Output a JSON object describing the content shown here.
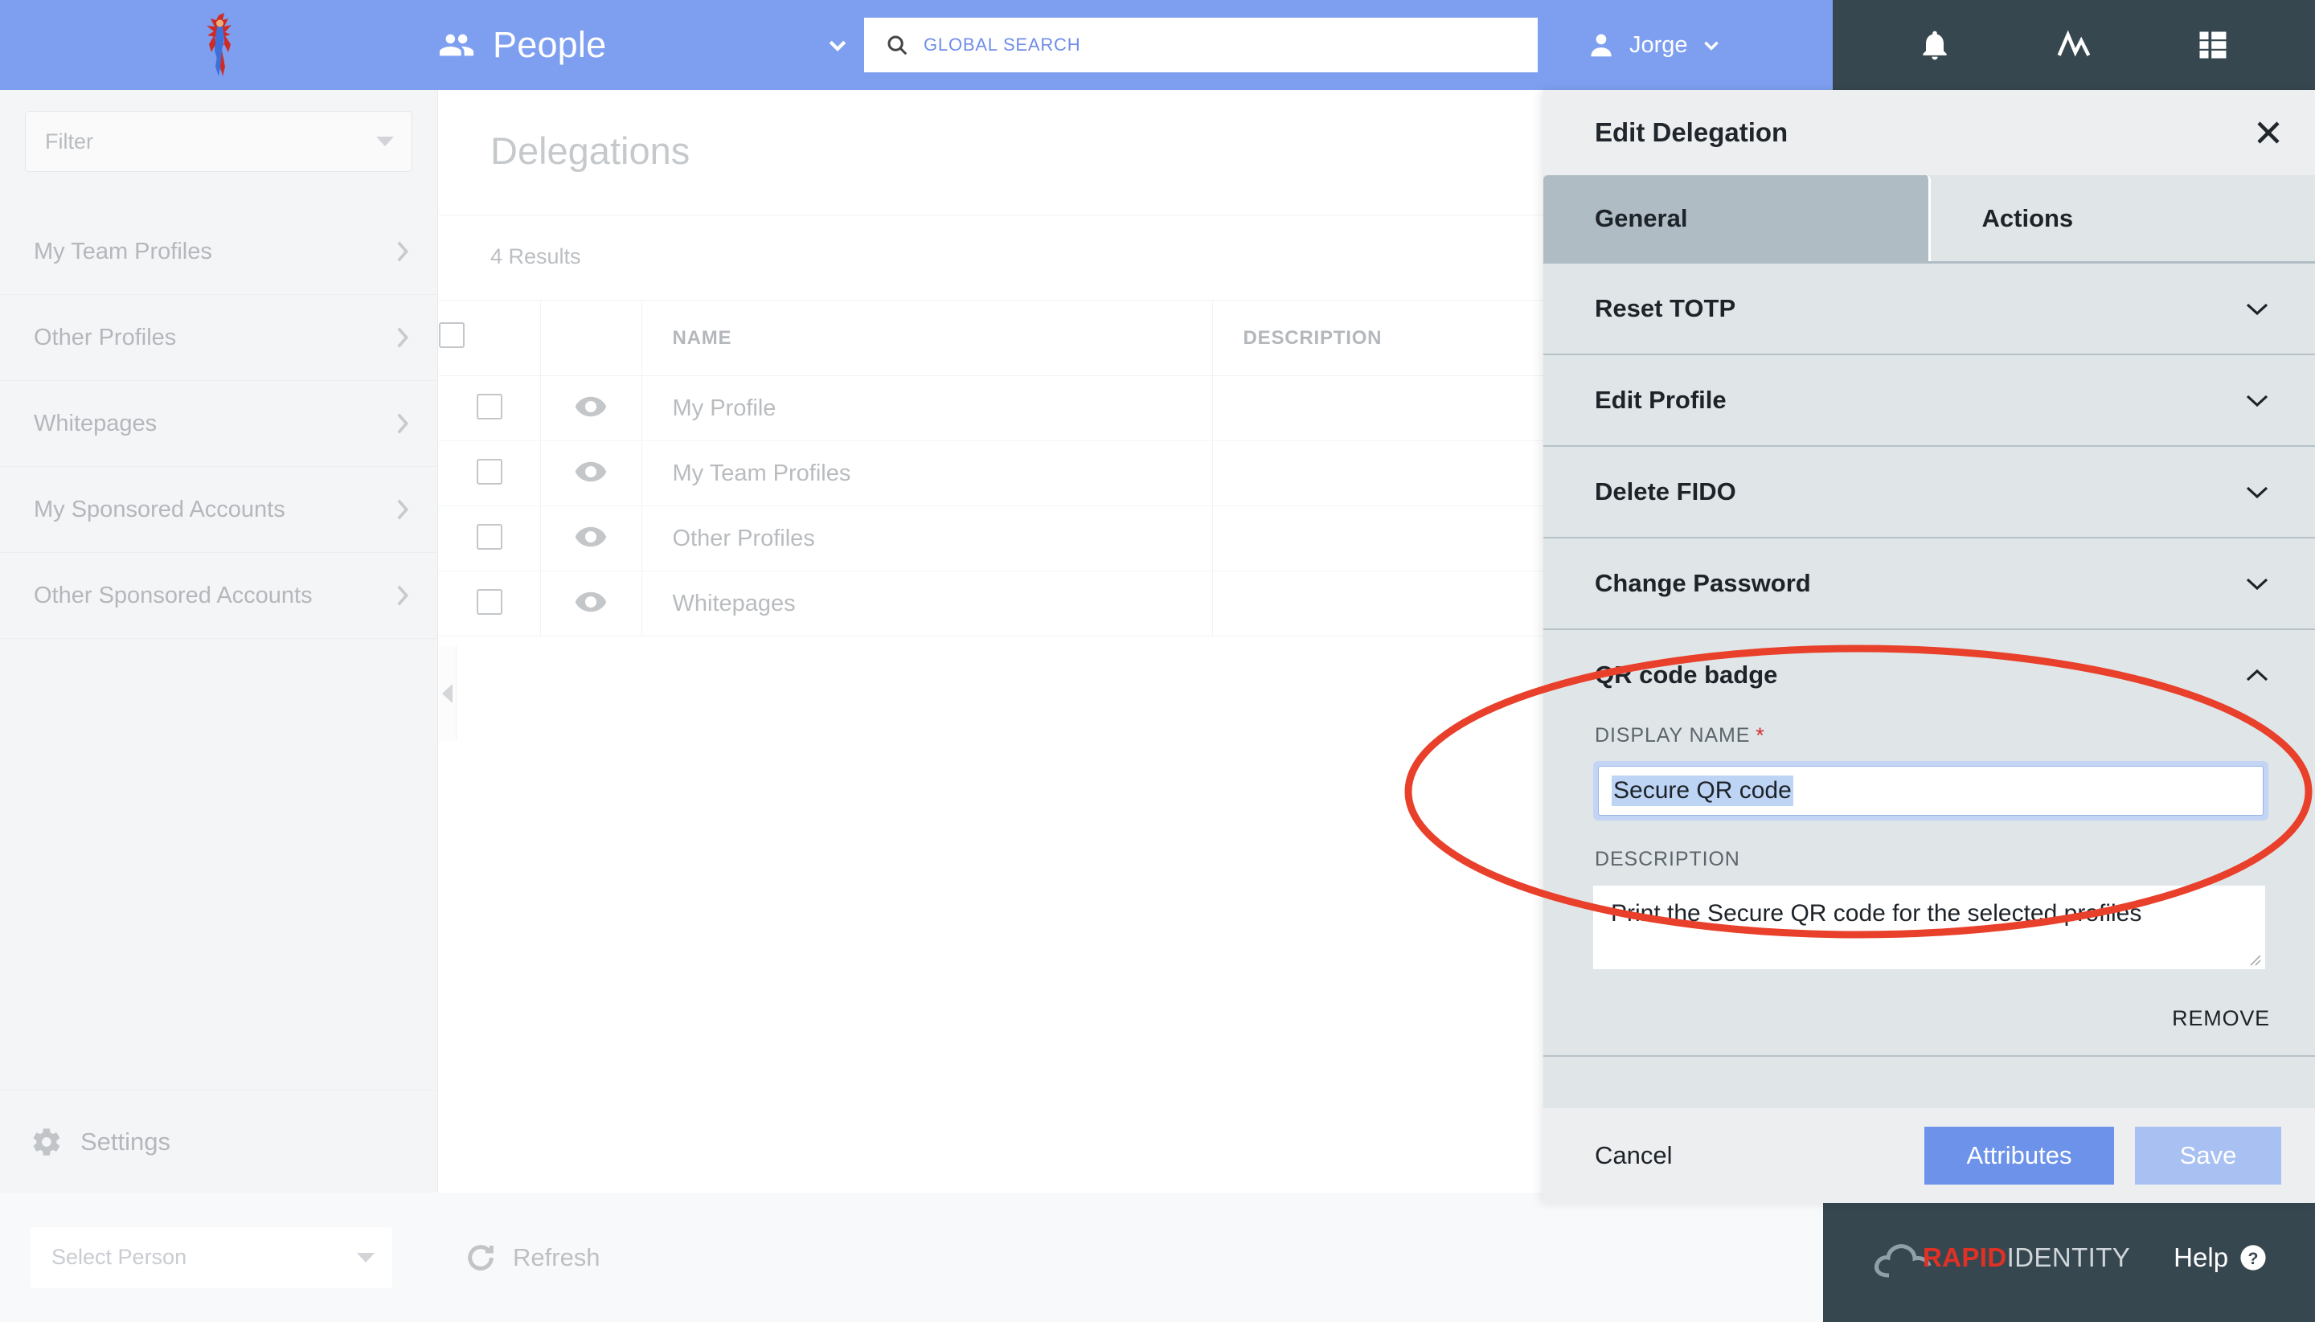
{
  "topbar": {
    "logo_name": "superhero-logo",
    "module": {
      "label": "People",
      "icon": "people-icon",
      "caret": "chevron-down-icon"
    },
    "search": {
      "placeholder": "GLOBAL SEARCH",
      "value": "",
      "icon": "search-icon"
    },
    "user": {
      "name": "Jorge",
      "icon": "person-icon",
      "caret": "chevron-down-icon"
    },
    "dark_icons": [
      "bell-icon",
      "trend-line-icon",
      "grid-list-icon"
    ]
  },
  "sidebar": {
    "filter": {
      "placeholder": "Filter",
      "value": ""
    },
    "items": [
      {
        "label": "My Team Profiles"
      },
      {
        "label": "Other Profiles"
      },
      {
        "label": "Whitepages"
      },
      {
        "label": "My Sponsored Accounts"
      },
      {
        "label": "Other Sponsored Accounts"
      }
    ],
    "settings_label": "Settings"
  },
  "main": {
    "page_title": "Delegations",
    "results_text": "4 Results",
    "columns": [
      "NAME",
      "DESCRIPTION"
    ],
    "rows": [
      {
        "name": "My Profile",
        "description": ""
      },
      {
        "name": "My Team Profiles",
        "description": ""
      },
      {
        "name": "Other Profiles",
        "description": ""
      },
      {
        "name": "Whitepages",
        "description": ""
      }
    ]
  },
  "bottombar": {
    "select_person_placeholder": "Select Person",
    "select_person_value": "",
    "refresh_label": "Refresh",
    "brand_rapid": "RAPID",
    "brand_identity": "IDENTITY",
    "help_label": "Help"
  },
  "panel": {
    "title": "Edit Delegation",
    "close_icon": "close-icon",
    "tabs": [
      {
        "label": "General",
        "active": true
      },
      {
        "label": "Actions",
        "active": false
      }
    ],
    "accordion": [
      {
        "label": "Reset TOTP"
      },
      {
        "label": "Edit Profile"
      },
      {
        "label": "Delete FIDO"
      },
      {
        "label": "Change Password"
      }
    ],
    "open_section": {
      "label": "QR code badge",
      "display_name_label": "DISPLAY NAME",
      "display_name_required": "*",
      "display_name_value": "Secure QR code",
      "description_label": "DESCRIPTION",
      "description_value": "Print the Secure QR code for the selected profiles",
      "remove_label": "REMOVE"
    },
    "footer": {
      "cancel_label": "Cancel",
      "attributes_label": "Attributes",
      "save_label": "Save"
    }
  },
  "colors": {
    "header_blue": "#7e9ff0",
    "dark_slate": "#37474f",
    "panel_bg": "#e0e5e8",
    "tab_active": "#b0bcc4",
    "accent_button": "#6d92ea",
    "annotation_red": "#e8402a",
    "brand_red": "#e03127"
  }
}
